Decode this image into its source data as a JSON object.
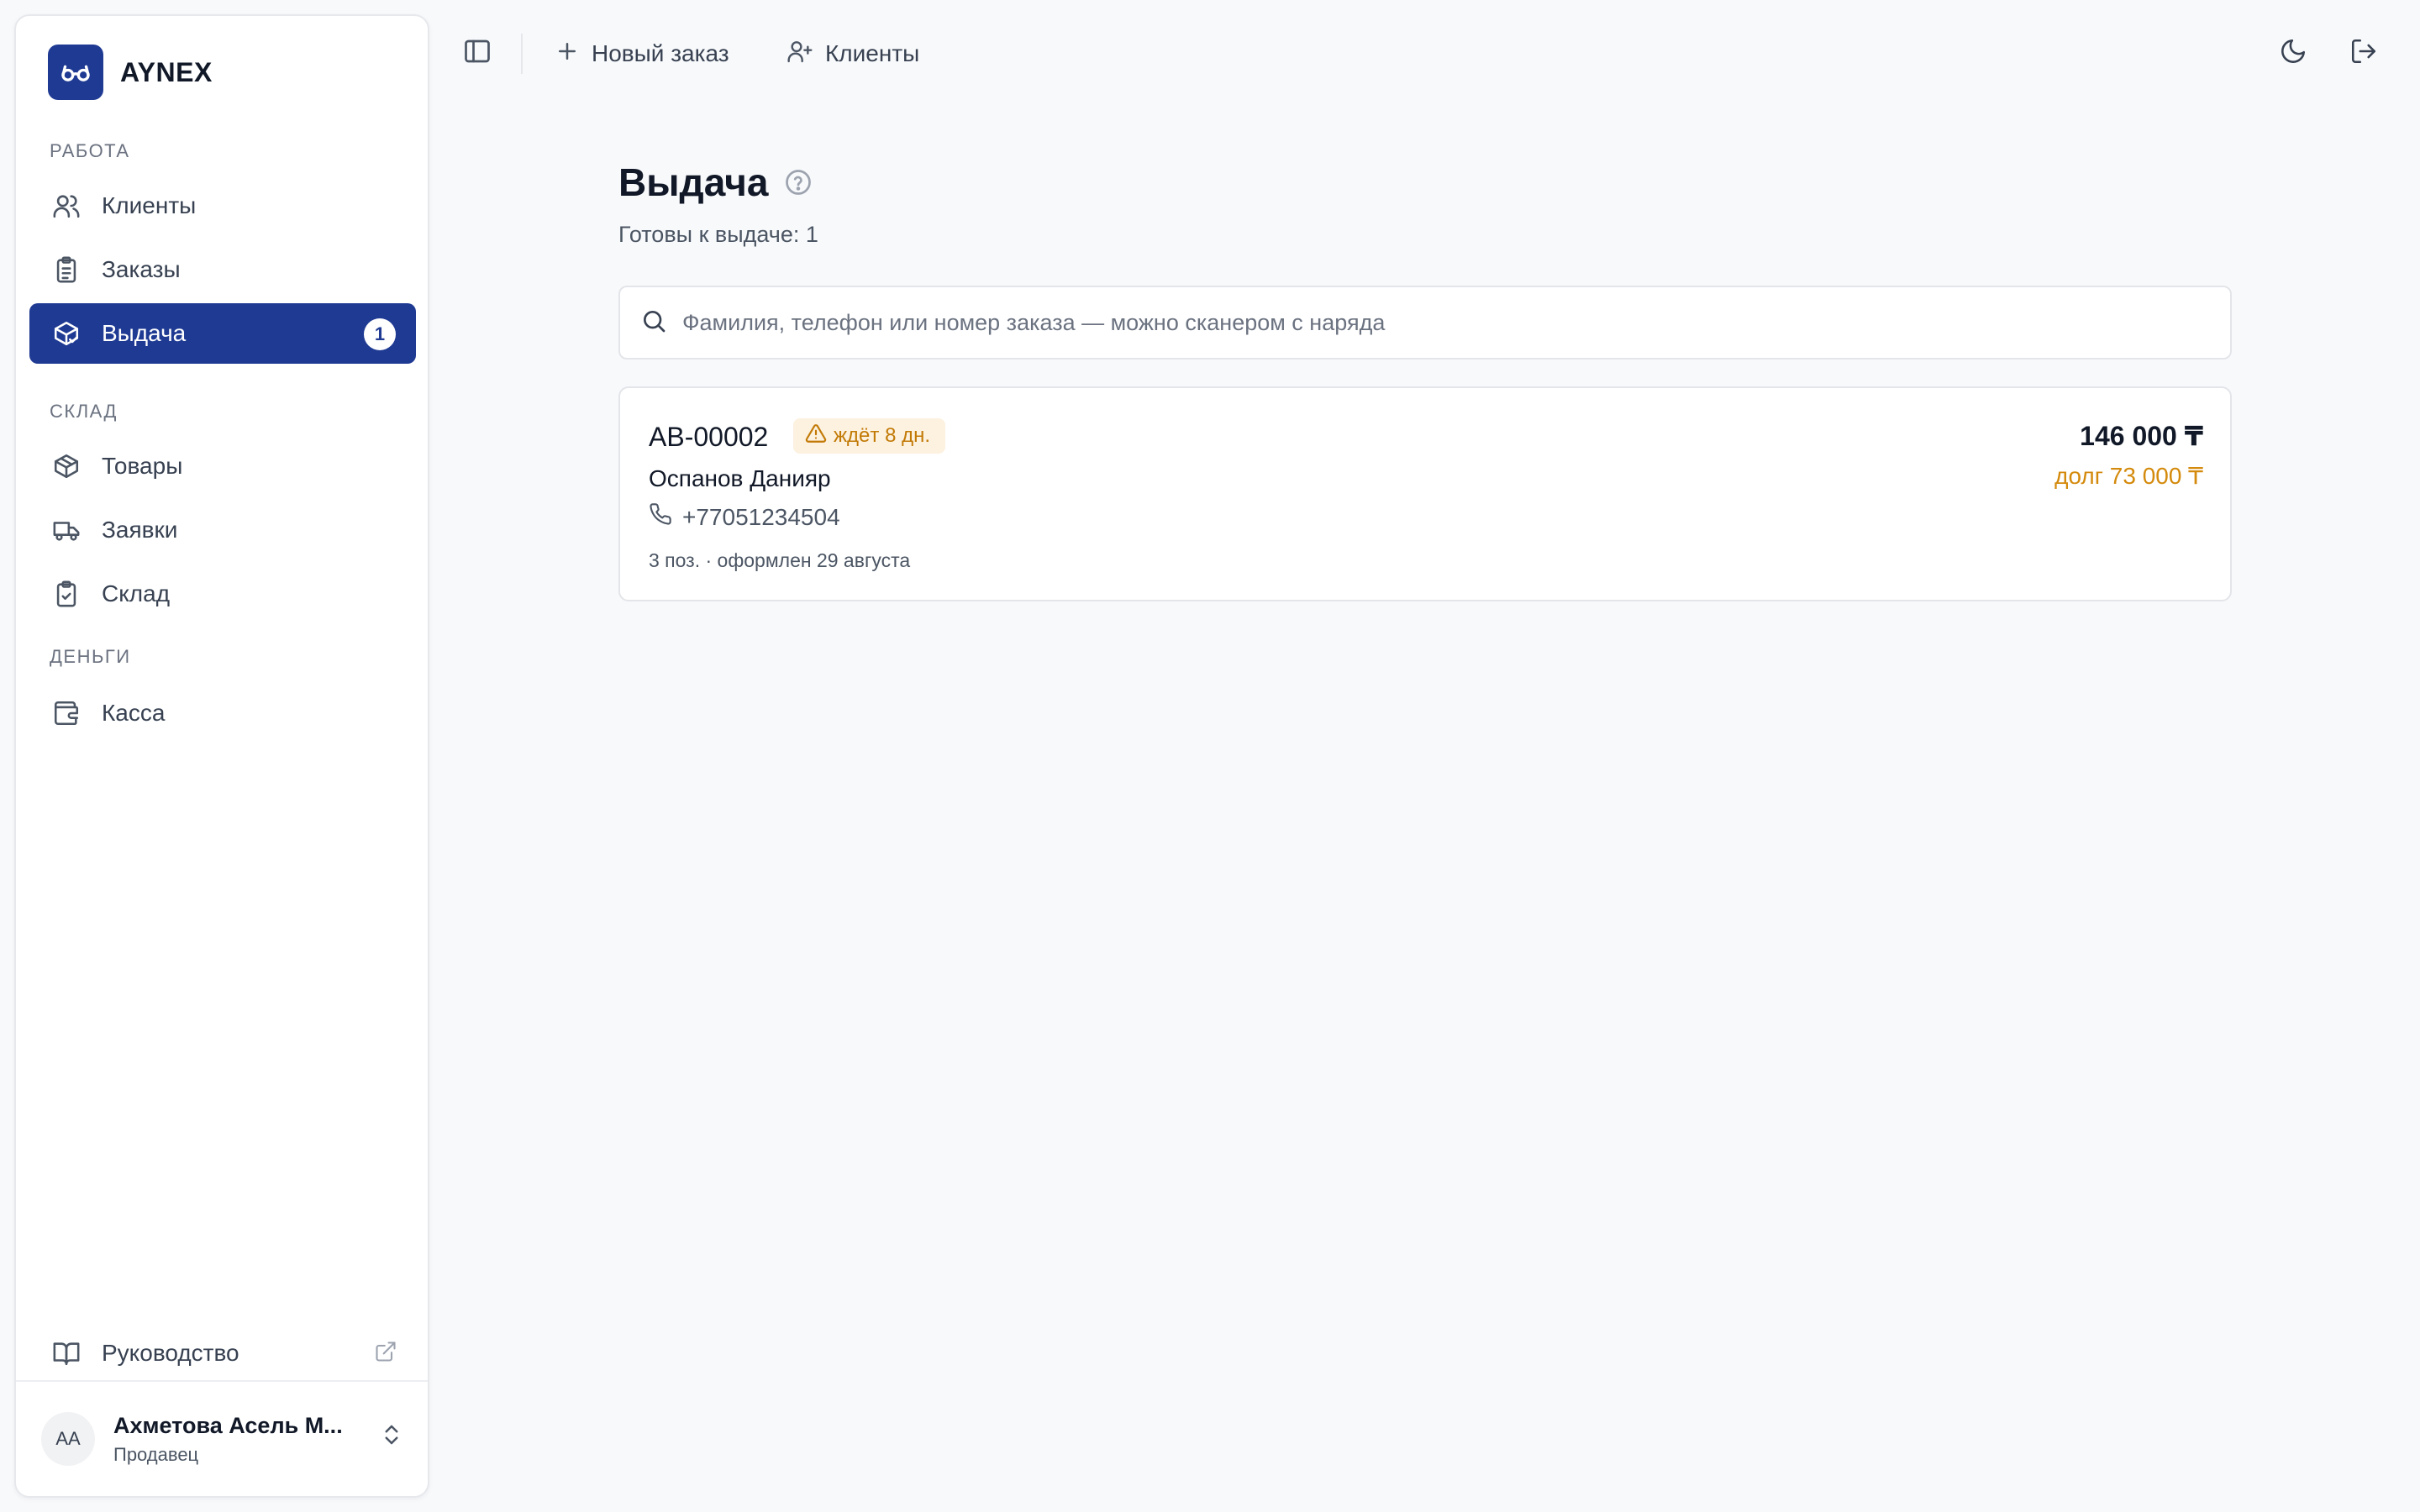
{
  "brand": {
    "name": "AYNEX",
    "logo_icon": "glasses-icon",
    "logo_color": "#1f3a93"
  },
  "sidebar": {
    "sections": [
      {
        "label": "РАБОТА"
      },
      {
        "label": "СКЛАД"
      },
      {
        "label": "ДЕНЬГИ"
      }
    ],
    "items": [
      {
        "label": "Клиенты",
        "icon": "users-icon"
      },
      {
        "label": "Заказы",
        "icon": "clipboard-list-icon"
      },
      {
        "label": "Выдача",
        "icon": "package-check-icon",
        "active": true,
        "badge": "1"
      },
      {
        "label": "Товары",
        "icon": "box-icon"
      },
      {
        "label": "Заявки",
        "icon": "truck-icon"
      },
      {
        "label": "Склад",
        "icon": "clipboard-check-icon"
      },
      {
        "label": "Касса",
        "icon": "wallet-icon"
      }
    ],
    "guide": {
      "label": "Руководство",
      "icon": "book-open-icon",
      "external_icon": "external-link-icon"
    },
    "user": {
      "initials": "АА",
      "name": "Ахметова Асель М...",
      "role": "Продавец"
    }
  },
  "topbar": {
    "toggle_icon": "sidebar-toggle-icon",
    "new_order": "Новый заказ",
    "clients": "Клиенты",
    "theme_icon": "moon-icon",
    "logout_icon": "logout-icon"
  },
  "main": {
    "title": "Выдача",
    "subtitle": "Готовы к выдаче: 1",
    "search_placeholder": "Фамилия, телефон или номер заказа — можно сканером с наряда",
    "orders": [
      {
        "id": "АВ-00002",
        "waiting": "ждёт 8 дн.",
        "client": "Оспанов Данияр",
        "phone": "+77051234504",
        "meta": "3 поз. · оформлен 29 августа",
        "total": "146 000 ₸",
        "debt": "долг 73 000 ₸"
      }
    ]
  },
  "colors": {
    "accent": "#1f3a93",
    "warning": "#d48a0c",
    "warning_bg": "#fdf1df"
  }
}
